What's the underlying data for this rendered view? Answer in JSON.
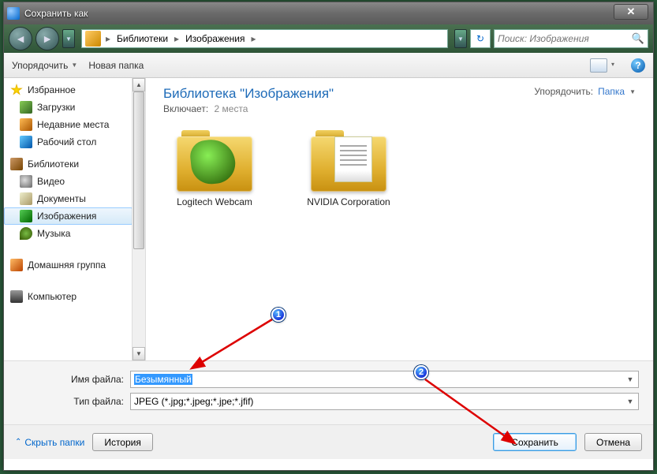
{
  "title": "Сохранить как",
  "breadcrumb": {
    "seg1": "Библиотеки",
    "seg2": "Изображения"
  },
  "search": {
    "placeholder": "Поиск: Изображения"
  },
  "toolbar": {
    "organize": "Упорядочить",
    "newfolder": "Новая папка"
  },
  "sidebar": {
    "favorites": "Избранное",
    "downloads": "Загрузки",
    "recent": "Недавние места",
    "desktop": "Рабочий стол",
    "libraries": "Библиотеки",
    "video": "Видео",
    "documents": "Документы",
    "images": "Изображения",
    "music": "Музыка",
    "homegroup": "Домашняя группа",
    "computer": "Компьютер"
  },
  "libheader": {
    "title": "Библиотека \"Изображения\"",
    "includes_label": "Включает:",
    "includes_count": "2 места",
    "arrange_label": "Упорядочить:",
    "arrange_value": "Папка"
  },
  "folders": [
    {
      "label": "Logitech Webcam"
    },
    {
      "label": "NVIDIA Corporation"
    }
  ],
  "form": {
    "name_label": "Имя файла:",
    "name_value": "Безымянный",
    "type_label": "Тип файла:",
    "type_value": "JPEG (*.jpg;*.jpeg;*.jpe;*.jfif)"
  },
  "footer": {
    "hide": "Скрыть папки",
    "history": "История",
    "save": "Сохранить",
    "cancel": "Отмена"
  },
  "markers": {
    "m1": "1",
    "m2": "2"
  }
}
